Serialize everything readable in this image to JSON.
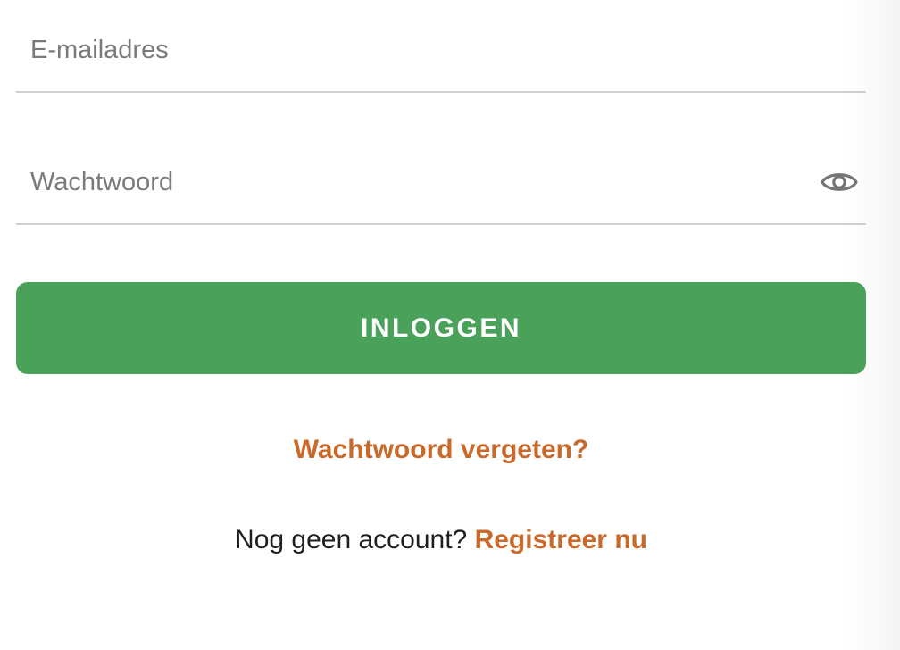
{
  "form": {
    "email": {
      "value": "",
      "placeholder": "E-mailadres"
    },
    "password": {
      "value": "",
      "placeholder": "Wachtwoord",
      "visibility_icon": "eye-icon"
    },
    "login_label": "INLOGGEN",
    "forgot_password_label": "Wachtwoord vergeten?",
    "no_account_prompt": "Nog geen account?",
    "register_label": "Registreer nu"
  },
  "colors": {
    "primary_button": "#4aa25a",
    "link_accent": "#c96a2b",
    "divider": "#cfcfcf",
    "placeholder_text": "#7a7a7a",
    "body_text": "#1f1f1f"
  }
}
